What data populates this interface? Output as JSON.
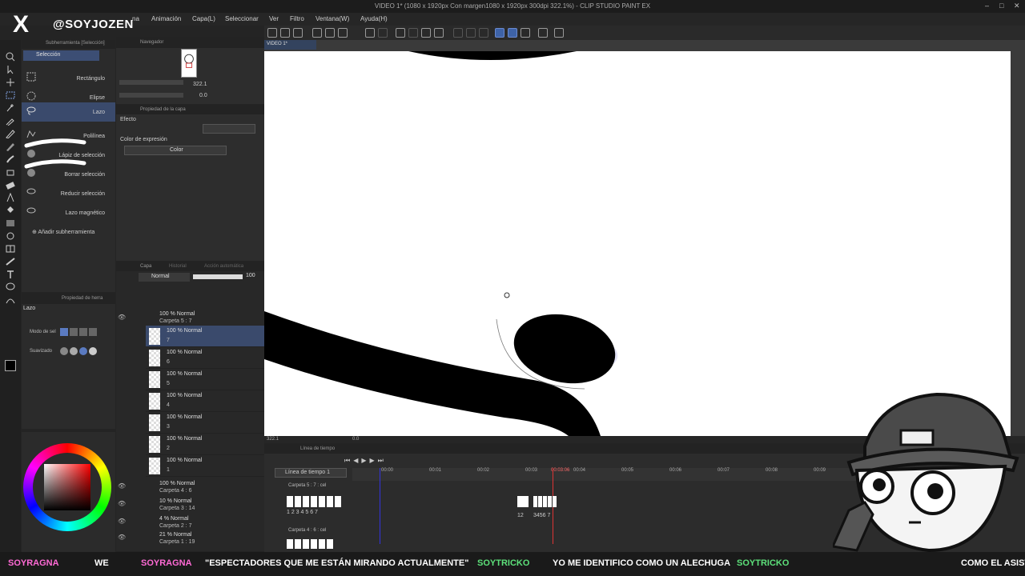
{
  "window": {
    "title": "VIDEO 1* (1080 x 1920px Con margen1080 x 1920px 300dpi 322.1%) - CLIP STUDIO PAINT EX",
    "controls": [
      "–",
      "□",
      "✕"
    ]
  },
  "menu": {
    "items": [
      "na",
      "Animación",
      "Capa(L)",
      "Seleccionar",
      "Ver",
      "Filtro",
      "Ventana(W)",
      "Ayuda(H)"
    ]
  },
  "overlay": {
    "x_logo": "X",
    "handle": "@SOYJOZEN"
  },
  "subtool": {
    "header": "Subherramienta [Selección]",
    "tab": "Selección",
    "items": [
      "Rectángulo",
      "Elipse",
      "Lazo",
      "Polilínea",
      "Lápiz de selección",
      "Borrar selección",
      "Reducir selección",
      "Lazo magnético"
    ],
    "selected_index": 2,
    "add_label": "Añadir subherramienta"
  },
  "tool_property": {
    "header": "Propiedad de herra",
    "tool_name": "Lazo",
    "mode_label": "Modo de sel",
    "smoothing_label": "Suavizado"
  },
  "navigator": {
    "header": "Navegador",
    "zoom": "322.1",
    "rotation": "0.0"
  },
  "layer_property": {
    "header": "Propiedad de la capa",
    "effect_label": "Efecto",
    "expression_color_label": "Color de expresión",
    "expression_color_value": "Color"
  },
  "layers": {
    "tabs": [
      "Capa",
      "Historial",
      "Acción automática"
    ],
    "blend_mode": "Normal",
    "opacity": "100",
    "folder_open": {
      "line1": "100 % Normal",
      "line2": "Carpeta 5 : 7"
    },
    "cels": [
      {
        "line1": "100 % Normal",
        "line2": "7"
      },
      {
        "line1": "100 % Normal",
        "line2": "6"
      },
      {
        "line1": "100 % Normal",
        "line2": "5"
      },
      {
        "line1": "100 % Normal",
        "line2": "4"
      },
      {
        "line1": "100 % Normal",
        "line2": "3"
      },
      {
        "line1": "100 % Normal",
        "line2": "2"
      },
      {
        "line1": "100 % Normal",
        "line2": "1"
      }
    ],
    "selected_cel": 0,
    "folders": [
      {
        "line1": "100 % Normal",
        "line2": "Carpeta 4 : 6"
      },
      {
        "line1": "10 % Normal",
        "line2": "Carpeta 3 : 14"
      },
      {
        "line1": "4 % Normal",
        "line2": "Carpeta 2 : 7"
      },
      {
        "line1": "21 % Normal",
        "line2": "Carpeta 1 : 19"
      }
    ]
  },
  "canvas": {
    "tab": "VIDEO 1*"
  },
  "status": {
    "zoom": "322.1",
    "angle": "0.0"
  },
  "timeline": {
    "header": "Línea de tiempo",
    "select": "Línea de tiempo 1",
    "current_time": "00:03:06",
    "ruler_marks": [
      "00:00",
      "00:01",
      "00:02",
      "00:03",
      "00:04",
      "00:05",
      "00:06",
      "00:07",
      "00:08",
      "00:09"
    ],
    "track1": "Carpeta 5 : 7 : cel",
    "track1_labels": [
      "1 2 3 4 5 6 7",
      "12",
      "3456 7"
    ],
    "track2": "Carpeta 4 : 6 : cel"
  },
  "chat": {
    "messages": [
      {
        "user": "SOYRAGNA",
        "text": "WE"
      },
      {
        "user": "SOYRAGNA",
        "text": "\"ESPECTADORES QUE ME ESTÁN MIRANDO ACTUALMENTE\""
      },
      {
        "user": "SOYTRICKO",
        "text": "YO ME IDENTIFICO COMO UN ALECHUGA"
      },
      {
        "user": "SOYTRICKO",
        "text": "COMO EL ASISTO"
      }
    ],
    "colors": {
      "user_ragna": "#ff6ad5",
      "user_tricko": "#5de07a"
    }
  }
}
